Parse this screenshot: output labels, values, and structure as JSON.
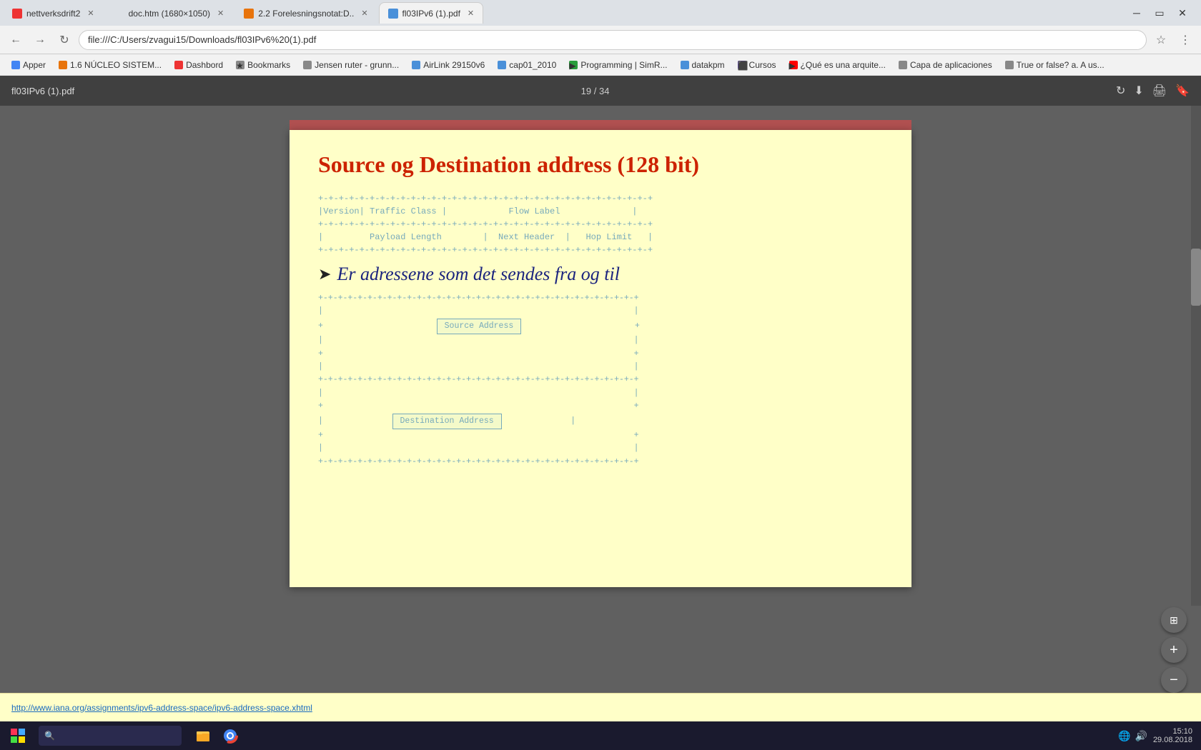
{
  "tabs": [
    {
      "id": 1,
      "label": "nettverksdrift2",
      "favicon_color": "red",
      "active": false
    },
    {
      "id": 2,
      "label": "doc.htm (1680×1050)",
      "favicon_color": "gray",
      "active": false
    },
    {
      "id": 3,
      "label": "2.2 Forelesningsnotat:D..",
      "favicon_color": "orange",
      "active": false
    },
    {
      "id": 4,
      "label": "fl03IPv6 (1).pdf",
      "favicon_color": "blue",
      "active": true
    }
  ],
  "address_bar": {
    "url": "file:///C:/Users/zvagui15/Downloads/fl03IPv6%20(1).pdf"
  },
  "bookmarks": [
    {
      "label": "Apper",
      "icon": "apps"
    },
    {
      "label": "1.6 NÚCLEO SISTEM...",
      "icon": "orange"
    },
    {
      "label": "Dashbord",
      "icon": "red"
    },
    {
      "label": "Bookmarks",
      "icon": "gray"
    },
    {
      "label": "Jensen ruter - grunn...",
      "icon": "gray"
    },
    {
      "label": "AirLink 29150v6",
      "icon": "blue"
    },
    {
      "label": "cap01_2010",
      "icon": "blue"
    },
    {
      "label": "Programming | SimR...",
      "icon": "green"
    },
    {
      "label": "datakpm",
      "icon": "blue"
    },
    {
      "label": "Cursos",
      "icon": "purple"
    },
    {
      "label": "¿Qué es una arquite...",
      "icon": "yt"
    },
    {
      "label": "Capa de aplicaciones",
      "icon": "gray"
    },
    {
      "label": "True or false? a. A us...",
      "icon": "gray"
    }
  ],
  "pdf_viewer": {
    "filename": "fl03IPv6 (1).pdf",
    "page_current": 19,
    "page_total": 34,
    "page_display": "19 / 34"
  },
  "slide": {
    "title": "Source og Destination address (128 bit)",
    "ascii_header_lines": [
      "+-+-+-+-+-+-+-+-+-+-+-+-+-+-+-+-+-+-+-+-+-+-+-+-+-+-+-+-+-+-+-+-+",
      "|Version| Traffic Class |                Flow Label              |",
      "+-+-+-+-+-+-+-+-+-+-+-+-+-+-+-+-+-+-+-+-+-+-+-+-+-+-+-+-+-+-+-+-+",
      "|         Payload Length        |  Next Header  |   Hop Limit   |",
      "+-+-+-+-+-+-+-+-+-+-+-+-+-+-+-+-+-+-+-+-+-+-+-+-+-+-+-+-+-+-+-+-+"
    ],
    "bullet_text": "Er adressene som det sendes fra og til",
    "source_address_label": "Source Address",
    "destination_address_label": "Destination Address",
    "ascii_diagram_lines": [
      "+-+-+-+-+-+-+-+-+-+-+-+-+-+-+-+-+-+-+-+-+-+-+-+-+-+-+-+-+-+-+-+-+",
      "|                                                               |",
      "+                                                               +",
      "|                                                               |",
      "+                       Source Address                         +",
      "|                                                               |",
      "+                                                               +",
      "|                                                               |",
      "+-+-+-+-+-+-+-+-+-+-+-+-+-+-+-+-+-+-+-+-+-+-+-+-+-+-+-+-+-+-+-+-+",
      "|                                                               |",
      "+                                                               +",
      "|                                                               |",
      "+                     Destination Address                      +",
      "|                                                               |",
      "+                                                               +",
      "|                                                               |",
      "+-+-+-+-+-+-+-+-+-+-+-+-+-+-+-+-+-+-+-+-+-+-+-+-+-+-+-+-+-+-+-+-+"
    ]
  },
  "bottom_link": "http://www.iana.org/assignments/ipv6-address-space/ipv6-address-space.xhtml",
  "taskbar": {
    "time": "15:10",
    "date": "29.08.2018"
  },
  "zoom_buttons": {
    "fit_label": "+",
    "zoom_in_label": "+",
    "zoom_out_label": "−"
  }
}
